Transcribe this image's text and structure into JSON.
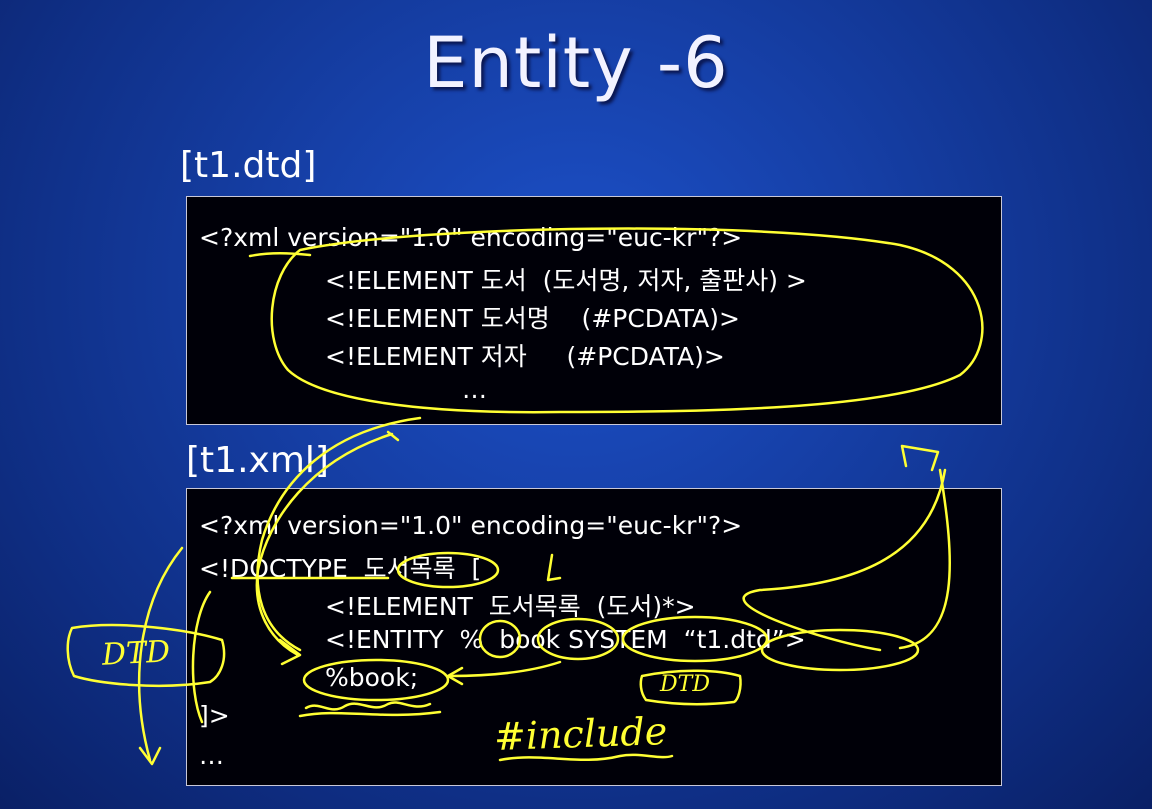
{
  "slide": {
    "title": "Entity -6",
    "dtd_label": "[t1.dtd]",
    "xml_label": "[t1.xml]"
  },
  "dtd_box": {
    "line1": "<?xml version=\"1.0\" encoding=\"euc-kr\"?>",
    "line2": "<!ELEMENT 도서  (도서명, 저자, 출판사) >",
    "line3": "<!ELEMENT 도서명    (#PCDATA)>",
    "line4": "<!ELEMENT 저자     (#PCDATA)>",
    "line5": "…"
  },
  "xml_box": {
    "line1": "<?xml version=\"1.0\" encoding=\"euc-kr\"?>",
    "line2": "<!DOCTYPE  도서목록  [",
    "line3": "<!ELEMENT  도서목록  (도서)*>",
    "line4": "<!ENTITY  %  book SYSTEM  “t1.dtd”>",
    "line5": "%book;",
    "line6": "]>",
    "line7": "…"
  },
  "annotations": {
    "dtd_left": "DTD",
    "dtd_mid": "DTD",
    "include": "#include",
    "ink_color": "#ffff33"
  }
}
